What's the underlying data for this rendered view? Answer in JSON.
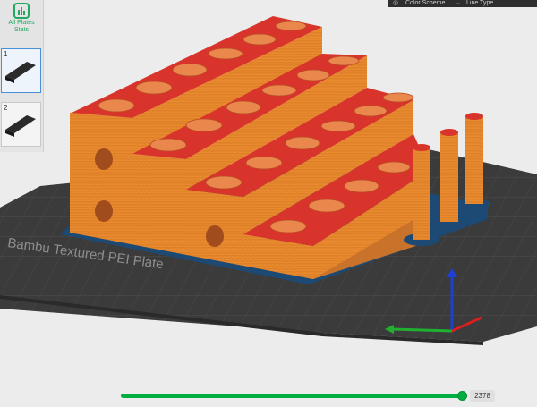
{
  "left_panel": {
    "stats_label_line1": "All Plates",
    "stats_label_line2": "Stats",
    "plates": [
      {
        "number": "1",
        "active": true
      },
      {
        "number": "2",
        "active": false
      }
    ]
  },
  "topbar": {
    "color_scheme_label": "Color Scheme",
    "line_type_label": "Line Type"
  },
  "scene": {
    "bed_label": "Bambu Textured PEI Plate"
  },
  "layer_slider": {
    "value": "2378"
  },
  "colors": {
    "accent": "#00ae42",
    "model_top": "#d8342c",
    "model_side": "#e98a2e",
    "bed": "#3a3a3a",
    "outline": "#1e4f7a"
  }
}
